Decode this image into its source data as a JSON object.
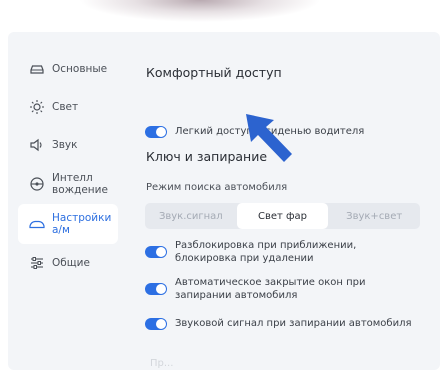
{
  "sidebar": {
    "items": [
      {
        "label": "Основные",
        "icon": "car-icon"
      },
      {
        "label": "Свет",
        "icon": "sun-icon"
      },
      {
        "label": "Звук",
        "icon": "speaker-icon"
      },
      {
        "label": "Интелл вождение",
        "icon": "steering-wheel-icon"
      },
      {
        "label": "Настройки а/м",
        "icon": "car-settings-icon",
        "active": true
      },
      {
        "label": "Общие",
        "icon": "sliders-icon"
      }
    ]
  },
  "comfort": {
    "title": "Комфортный доступ",
    "easy_access_label": "Легкий доступ к сиденью водителя",
    "easy_access_on": true
  },
  "locking": {
    "title": "Ключ и запирание",
    "search_mode_label": "Режим поиска автомобиля",
    "search_modes": [
      "Звук.сигнал",
      "Свет фар",
      "Звук+свет"
    ],
    "search_mode_selected": "Свет фар",
    "options": [
      {
        "label": "Разблокировка при приближении, блокировка при удалении",
        "on": true
      },
      {
        "label": "Автоматическое закрытие окон при запирании автомобиля",
        "on": true
      },
      {
        "label": "Звуковой сигнал при запирании автомобиля",
        "on": true
      }
    ]
  },
  "footer_faded_text": "Пр...",
  "colors": {
    "accent": "#2c6fe3",
    "panel_bg": "#f3f5f8"
  }
}
